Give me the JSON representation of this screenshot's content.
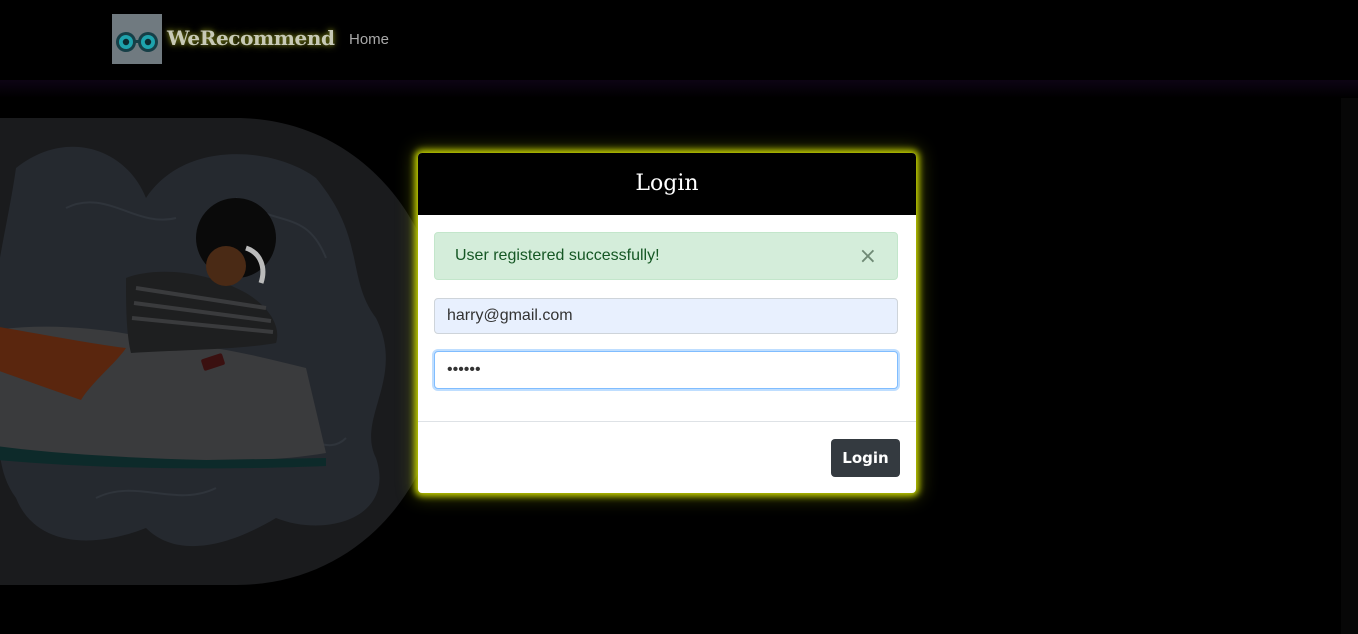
{
  "navbar": {
    "brand_name": "WeRecommend",
    "links": [
      {
        "label": "Home"
      }
    ]
  },
  "modal": {
    "title": "Login",
    "alert": {
      "message": "User registered successfully!",
      "close_glyph": "×"
    },
    "email_value": "harry@gmail.com",
    "password_value": "••••••",
    "submit_label": "Login"
  },
  "colors": {
    "page_background": "#000000",
    "modal_glow": "#c7d400",
    "alert_background": "#d4edda",
    "alert_text": "#155724",
    "button_background": "#343a40",
    "email_autofill_background": "#e8f0fe"
  },
  "icons": [
    "logo-icon",
    "close-icon"
  ]
}
